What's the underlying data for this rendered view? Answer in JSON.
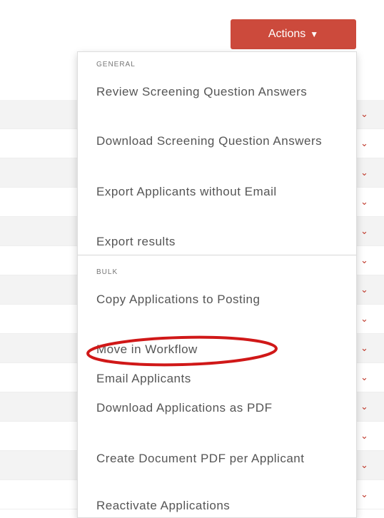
{
  "header": {
    "actions_label": "Actions"
  },
  "menu": {
    "general_header": "GENERAL",
    "bulk_header": "BULK",
    "general_items": [
      {
        "label": "Review Screening Question Answers"
      },
      {
        "label": "Download Screening Question Answers"
      },
      {
        "label": "Export Applicants without Email"
      },
      {
        "label": "Export results"
      }
    ],
    "bulk_items": [
      {
        "label": "Copy Applications to Posting"
      },
      {
        "label": "Move in Workflow",
        "highlighted": true
      },
      {
        "label": "Email Applicants"
      },
      {
        "label": "Download Applications as PDF"
      },
      {
        "label": "Create Document PDF per Applicant"
      },
      {
        "label": "Reactivate Applications"
      }
    ]
  },
  "colors": {
    "accent": "#cc4a3c",
    "highlight_ring": "#d01818",
    "menu_text": "#555555"
  },
  "icons": {
    "actions_chevron": "chevron-down-icon",
    "row_caret": "chevron-down-icon"
  }
}
